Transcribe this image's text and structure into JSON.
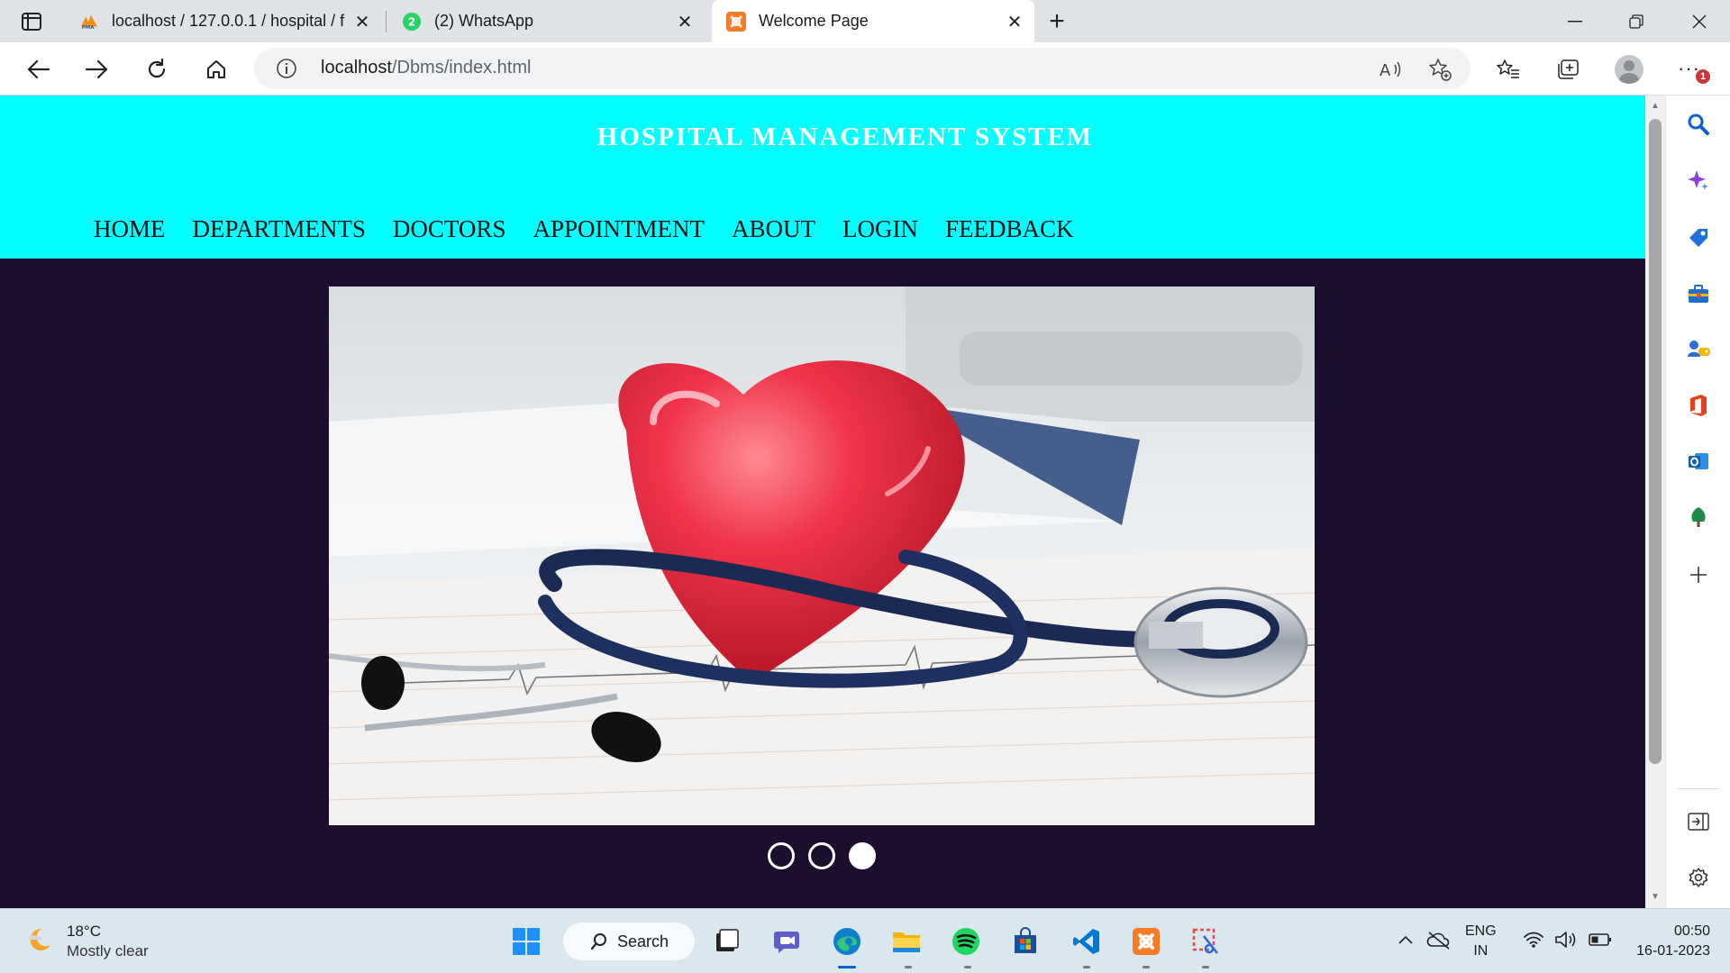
{
  "browser": {
    "tabs": [
      {
        "title": "localhost / 127.0.0.1 / hospital / f",
        "favicon": "phpmyadmin-icon"
      },
      {
        "title": "(2) WhatsApp",
        "favicon": "whatsapp-icon",
        "badge": "2"
      },
      {
        "title": "Welcome Page",
        "favicon": "xampp-icon",
        "active": true
      }
    ],
    "address": {
      "host": "localhost",
      "path": "/Dbms/index.html"
    },
    "notification_badge": "1"
  },
  "page": {
    "title": "HOSPITAL MANAGEMENT SYSTEM",
    "nav": [
      "HOME",
      "DEPARTMENTS",
      "DOCTORS",
      "APPOINTMENT",
      "ABOUT",
      "LOGIN",
      "FEEDBACK"
    ],
    "carousel": {
      "slide_count": 3,
      "active_index": 2
    },
    "colors": {
      "header_bg": "#00ffff",
      "page_bg": "#1c0f2d",
      "title_color": "#ffffff"
    }
  },
  "taskbar": {
    "weather": {
      "temp": "18°C",
      "condition": "Mostly clear"
    },
    "search_label": "Search",
    "language": {
      "line1": "ENG",
      "line2": "IN"
    },
    "clock": {
      "time": "00:50",
      "date": "16-01-2023"
    }
  }
}
